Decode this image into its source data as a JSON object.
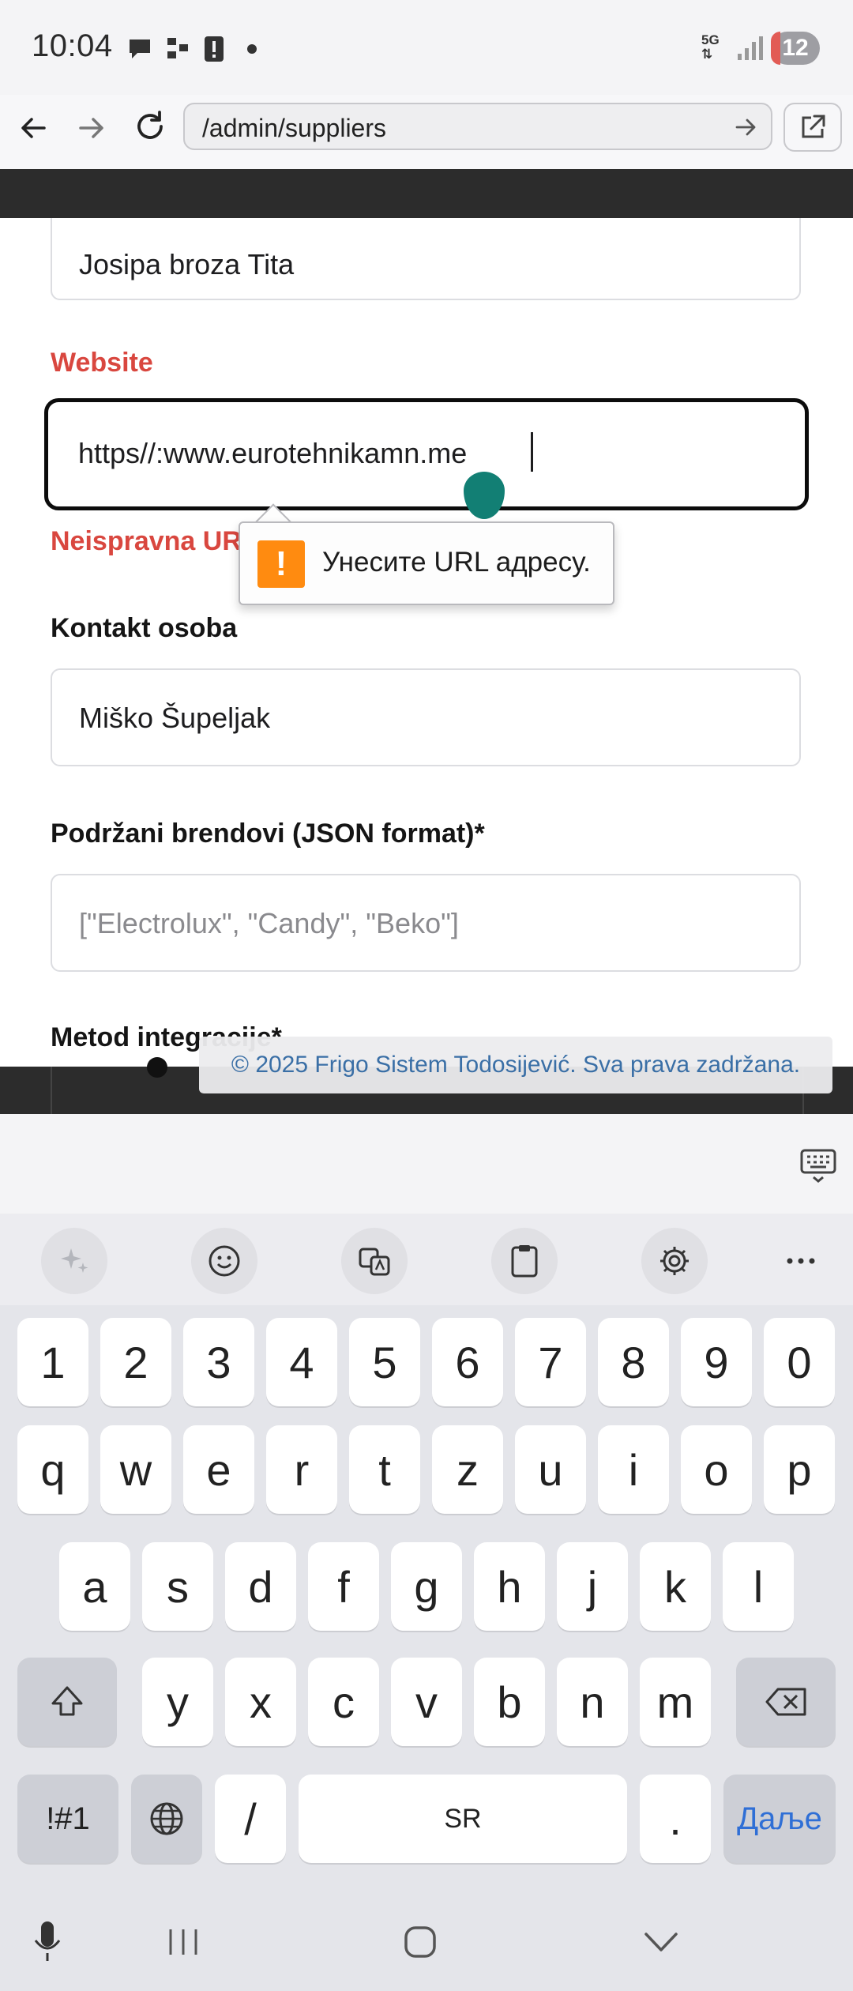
{
  "status_bar": {
    "time": "10:04",
    "network_label": "5G",
    "battery_level": "12",
    "icons": [
      "chat-icon",
      "network-icon",
      "alert-icon",
      "dot-icon",
      "5g-icon",
      "signal-icon"
    ]
  },
  "browser": {
    "url": "/admin/suppliers",
    "icons": [
      "back-icon",
      "forward-icon",
      "reload-icon",
      "go-icon",
      "external-link-icon"
    ]
  },
  "form": {
    "address_value": "Josipa broza Tita",
    "website_label": "Website",
    "website_value": "https//:www.eurotehnikamn.me",
    "website_error": "Neispravna UR",
    "contact_label": "Kontakt osoba",
    "contact_value": "Miško Šupeljak",
    "brands_label": "Podržani brendovi (JSON format)*",
    "brands_placeholder": "[\"Electrolux\", \"Candy\", \"Beko\"]",
    "integration_label": "Metod integracije*"
  },
  "tooltip": {
    "icon": "!",
    "text": "Унесите URL адресу."
  },
  "footer": {
    "text": "© 2025 Frigo Sistem Todosijević. Sva prava zadržana."
  },
  "keyboard": {
    "toolbar_icons": [
      "ai-sparkle-icon",
      "emoji-icon",
      "translate-icon",
      "clipboard-icon",
      "settings-icon",
      "more-icon"
    ],
    "row_numbers": [
      "1",
      "2",
      "3",
      "4",
      "5",
      "6",
      "7",
      "8",
      "9",
      "0"
    ],
    "row1": [
      "q",
      "w",
      "e",
      "r",
      "t",
      "z",
      "u",
      "i",
      "o",
      "p"
    ],
    "row2": [
      "a",
      "s",
      "d",
      "f",
      "g",
      "h",
      "j",
      "k",
      "l"
    ],
    "row3": [
      "y",
      "x",
      "c",
      "v",
      "b",
      "n",
      "m"
    ],
    "symbols_label": "!#1",
    "slash_label": "/",
    "space_label": "SR",
    "period_label": ".",
    "enter_label": "Даље"
  },
  "colors": {
    "error": "#d9473f",
    "handle": "#127f74",
    "tooltip_icon": "#ff8b10",
    "footer_link": "#3a6fa6",
    "enter_key_text": "#2f6fd6"
  }
}
